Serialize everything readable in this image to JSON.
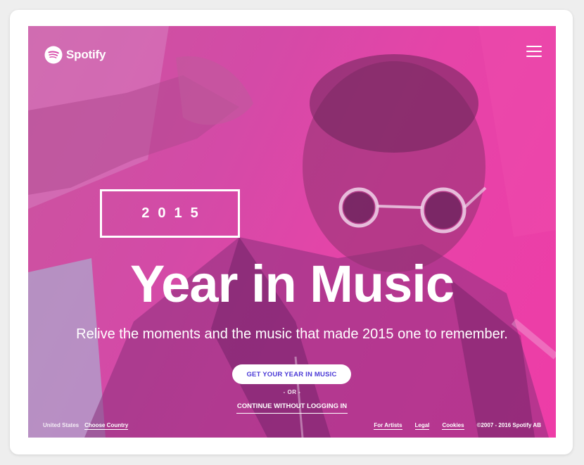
{
  "brand": {
    "name": "Spotify",
    "logo_icon": "spotify-logo-icon",
    "accent": "#4b3ad6",
    "hero_colors": [
      "#c9559e",
      "#ee3ca7"
    ]
  },
  "header": {
    "menu_icon": "hamburger-menu-icon"
  },
  "hero": {
    "year": "2015",
    "headline": "Year in Music",
    "subline": "Relive the moments and the music that made 2015 one to remember.",
    "primary_cta": "GET YOUR YEAR IN MUSIC",
    "or_text": "- OR -",
    "secondary_cta": "CONTINUE WITHOUT LOGGING IN"
  },
  "footer": {
    "country": "United States",
    "choose_country": "Choose Country",
    "links": [
      "For Artists",
      "Legal",
      "Cookies"
    ],
    "copyright": "©2007 - 2016 Spotify AB"
  }
}
